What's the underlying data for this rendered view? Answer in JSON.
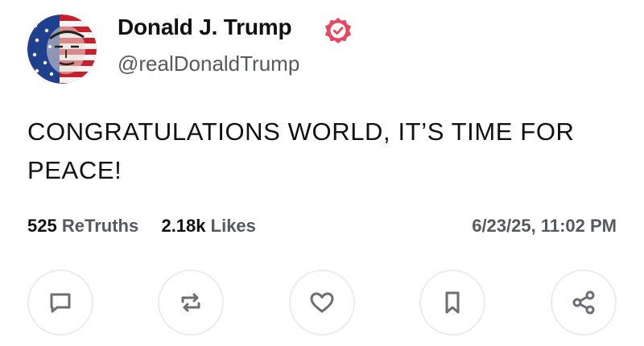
{
  "author": {
    "display_name": "Donald J. Trump",
    "handle": "@realDonaldTrump",
    "verified": true,
    "avatar_icon": "flag-portrait-avatar"
  },
  "post": {
    "text": "CONGRATULATIONS WORLD, IT’S TIME FOR PEACE!",
    "retruths_count": "525",
    "retruths_label": "ReTruths",
    "likes_count": "2.18k",
    "likes_label": "Likes",
    "timestamp": "6/23/25, 11:02 PM"
  },
  "actions": [
    {
      "name": "reply",
      "icon": "comment-icon"
    },
    {
      "name": "retruth",
      "icon": "repost-icon"
    },
    {
      "name": "like",
      "icon": "heart-icon"
    },
    {
      "name": "bookmark",
      "icon": "bookmark-icon"
    },
    {
      "name": "share",
      "icon": "share-icon"
    }
  ],
  "colors": {
    "verified_badge": "#e8475f",
    "muted_text": "#555a60",
    "icon_stroke": "#6b6f75"
  }
}
